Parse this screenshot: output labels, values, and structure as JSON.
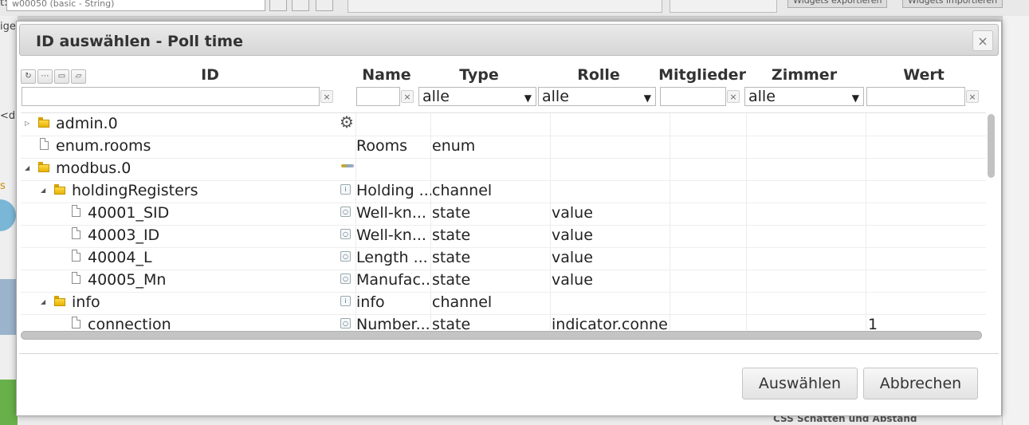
{
  "background": {
    "select_text": "w00050 (basic - String)",
    "export_buttons": [
      "Widgets exportieren",
      "Widgets importieren"
    ],
    "left_labels": [
      "t:",
      "ige",
      "<d",
      "s"
    ],
    "bottom_label": "CSS Schatten und Abstand"
  },
  "dialog": {
    "title": "ID auswählen - Poll time",
    "close_icon": "×"
  },
  "columns": {
    "id": "ID",
    "name": "Name",
    "type": "Type",
    "role": "Rolle",
    "members": "Mitglieder",
    "rooms": "Zimmer",
    "value": "Wert"
  },
  "toolbar_icons": [
    "refresh-icon",
    "list-icon",
    "folder-collapse-icon",
    "folder-expand-icon"
  ],
  "filters": {
    "id": "",
    "name": "",
    "type": "alle",
    "role": "alle",
    "rooms": "alle",
    "value": "",
    "clear": "×"
  },
  "rows": [
    {
      "id": "admin.0",
      "name": "",
      "type": "",
      "role": "",
      "value": ""
    },
    {
      "id": "enum.rooms",
      "name": "Rooms",
      "type": "enum",
      "role": "",
      "value": ""
    },
    {
      "id": "modbus.0",
      "name": "",
      "type": "",
      "role": "",
      "value": ""
    },
    {
      "id": "holdingRegisters",
      "name": "Holding ...",
      "type": "channel",
      "role": "",
      "value": ""
    },
    {
      "id": "40001_SID",
      "name": "Well-kn...",
      "type": "state",
      "role": "value",
      "value": ""
    },
    {
      "id": "40003_ID",
      "name": "Well-kn...",
      "type": "state",
      "role": "value",
      "value": ""
    },
    {
      "id": "40004_L",
      "name": "Length ...",
      "type": "state",
      "role": "value",
      "value": ""
    },
    {
      "id": "40005_Mn",
      "name": "Manufac...",
      "type": "state",
      "role": "value",
      "value": ""
    },
    {
      "id": "info",
      "name": "info",
      "type": "channel",
      "role": "",
      "value": ""
    },
    {
      "id": "connection",
      "name": "Number...",
      "type": "state",
      "role": "indicator.conne",
      "value": "1"
    }
  ],
  "buttons": {
    "select": "Auswählen",
    "cancel": "Abbrechen"
  },
  "glyphs": {
    "expanded": "◢",
    "collapsed": "▷",
    "gear": "⚙",
    "info": "i",
    "state": "○"
  }
}
